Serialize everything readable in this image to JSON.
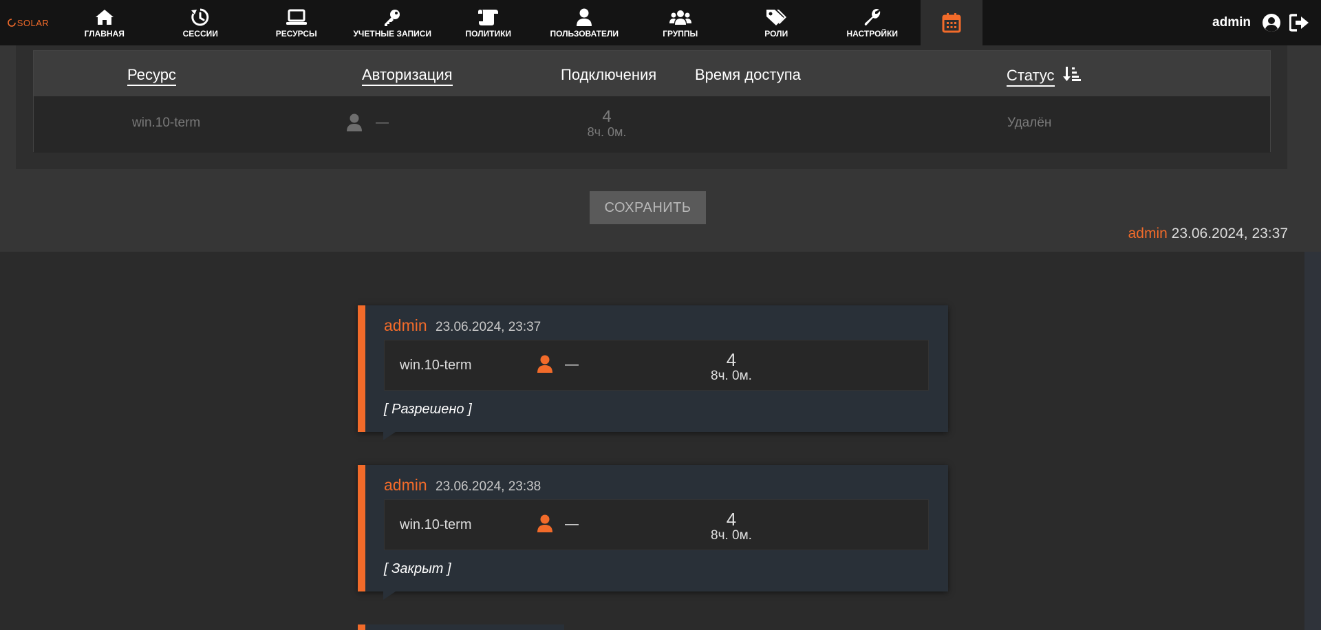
{
  "nav": {
    "logo": "SOLAR",
    "items": [
      {
        "label": "ГЛАВНАЯ",
        "icon": "home-icon"
      },
      {
        "label": "СЕССИИ",
        "icon": "history-icon"
      },
      {
        "label": "РЕСУРСЫ",
        "icon": "laptop-icon"
      },
      {
        "label": "УЧЕТНЫЕ ЗАПИСИ",
        "icon": "key-icon"
      },
      {
        "label": "ПОЛИТИКИ",
        "icon": "scroll-icon"
      },
      {
        "label": "ПОЛЬЗОВАТЕЛИ",
        "icon": "user-icon"
      },
      {
        "label": "ГРУППЫ",
        "icon": "users-icon"
      },
      {
        "label": "РОЛИ",
        "icon": "tags-icon"
      },
      {
        "label": "НАСТРОЙКИ",
        "icon": "wrench-icon"
      }
    ],
    "active_icon": "calendar-icon",
    "user": "admin",
    "accent": "#f26b2a"
  },
  "table": {
    "headers": {
      "resource": "Ресурс",
      "auth": "Авторизация",
      "connections": "Подключения",
      "access_time": "Время доступа",
      "status": "Статус"
    },
    "row": {
      "resource": "win.10-term",
      "auth": "—",
      "count": "4",
      "duration": "8ч. 0м.",
      "status": "Удалён"
    }
  },
  "save_label": "СОХРАНИТЬ",
  "upper_meta": {
    "user": "admin",
    "datetime": "23.06.2024, 23:37"
  },
  "history": [
    {
      "user": "admin",
      "datetime": "23.06.2024, 23:37",
      "resource": "win.10-term",
      "auth": "—",
      "count": "4",
      "duration": "8ч. 0м.",
      "status": "[ Разрешено ]"
    },
    {
      "user": "admin",
      "datetime": "23.06.2024, 23:38",
      "resource": "win.10-term",
      "auth": "—",
      "count": "4",
      "duration": "8ч. 0м.",
      "status": "[ Закрыт ]"
    }
  ]
}
